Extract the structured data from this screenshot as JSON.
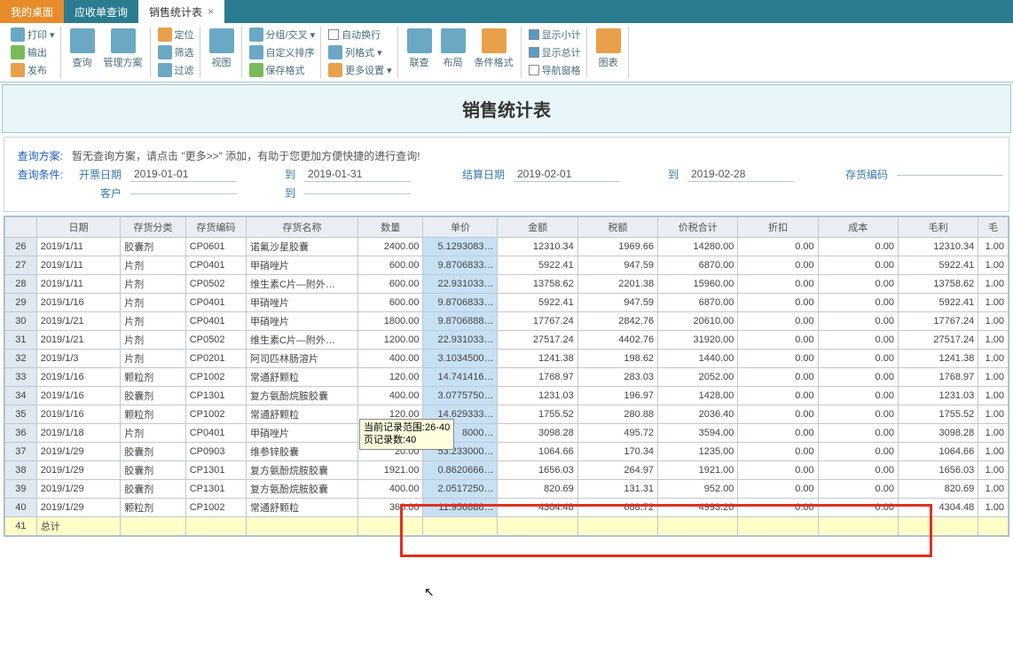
{
  "tabs": {
    "desktop": "我的桌面",
    "ar": "应收单查询",
    "active": "销售统计表"
  },
  "ribbon": {
    "print": "打印",
    "export": "输出",
    "publish": "发布",
    "query": "查询",
    "scheme": "管理方案",
    "locate": "定位",
    "filter": "筛选",
    "clearfilter": "过滤",
    "view": "视图",
    "group": "分组/交叉",
    "customsort": "自定义排序",
    "saveformat": "保存格式",
    "autowrap": "自动换行",
    "colformat": "列格式",
    "moresetting": "更多设置",
    "related": "联查",
    "layout": "布局",
    "condformat": "条件格式",
    "subtotal": "显示小计",
    "grandtotal": "显示总计",
    "navpane": "导航窗格",
    "chart": "图表"
  },
  "title": "销售统计表",
  "query": {
    "scheme_label": "查询方案:",
    "scheme_hint": "暂无查询方案，请点击 \"更多>>\" 添加，有助于您更加方便快捷的进行查询!",
    "cond_label": "查询条件:",
    "invoice_date": "开票日期",
    "d1": "2019-01-01",
    "to": "到",
    "d2": "2019-01-31",
    "settle_date": "结算日期",
    "d3": "2019-02-01",
    "d4": "2019-02-28",
    "inv_code": "存货编码",
    "customer": "客户"
  },
  "headers": [
    "日期",
    "存货分类",
    "存货编码",
    "存货名称",
    "数量",
    "单价",
    "金额",
    "税额",
    "价税合计",
    "折扣",
    "成本",
    "毛利",
    "毛"
  ],
  "tooltip": {
    "l1": "当前记录范围:26-40",
    "l2": "页记录数:40"
  },
  "rows": [
    {
      "n": 26,
      "date": "2019/1/11",
      "cat": "胶囊剂",
      "code": "CP0601",
      "name": "诺氟沙星胶囊",
      "qty": "2400.00",
      "price": "5.1293083…",
      "amt": "12310.34",
      "tax": "1969.66",
      "tot": "14280.00",
      "disc": "0.00",
      "cost": "0.00",
      "gp": "12310.34",
      "r": "1.00"
    },
    {
      "n": 27,
      "date": "2019/1/11",
      "cat": "片剂",
      "code": "CP0401",
      "name": "甲硝唑片",
      "qty": "600.00",
      "price": "9.8706833…",
      "amt": "5922.41",
      "tax": "947.59",
      "tot": "6870.00",
      "disc": "0.00",
      "cost": "0.00",
      "gp": "5922.41",
      "r": "1.00"
    },
    {
      "n": 28,
      "date": "2019/1/11",
      "cat": "片剂",
      "code": "CP0502",
      "name": "维生素C片—附外…",
      "qty": "600.00",
      "price": "22.931033…",
      "amt": "13758.62",
      "tax": "2201.38",
      "tot": "15960.00",
      "disc": "0.00",
      "cost": "0.00",
      "gp": "13758.62",
      "r": "1.00"
    },
    {
      "n": 29,
      "date": "2019/1/16",
      "cat": "片剂",
      "code": "CP0401",
      "name": "甲硝唑片",
      "qty": "600.00",
      "price": "9.8706833…",
      "amt": "5922.41",
      "tax": "947.59",
      "tot": "6870.00",
      "disc": "0.00",
      "cost": "0.00",
      "gp": "5922.41",
      "r": "1.00"
    },
    {
      "n": 30,
      "date": "2019/1/21",
      "cat": "片剂",
      "code": "CP0401",
      "name": "甲硝唑片",
      "qty": "1800.00",
      "price": "9.8706888…",
      "amt": "17767.24",
      "tax": "2842.76",
      "tot": "20610.00",
      "disc": "0.00",
      "cost": "0.00",
      "gp": "17767.24",
      "r": "1.00"
    },
    {
      "n": 31,
      "date": "2019/1/21",
      "cat": "片剂",
      "code": "CP0502",
      "name": "维生素C片—附外…",
      "qty": "1200.00",
      "price": "22.931033…",
      "amt": "27517.24",
      "tax": "4402.76",
      "tot": "31920.00",
      "disc": "0.00",
      "cost": "0.00",
      "gp": "27517.24",
      "r": "1.00"
    },
    {
      "n": 32,
      "date": "2019/1/3",
      "cat": "片剂",
      "code": "CP0201",
      "name": "阿司匹林肠溶片",
      "qty": "400.00",
      "price": "3.1034500…",
      "amt": "1241.38",
      "tax": "198.62",
      "tot": "1440.00",
      "disc": "0.00",
      "cost": "0.00",
      "gp": "1241.38",
      "r": "1.00"
    },
    {
      "n": 33,
      "date": "2019/1/16",
      "cat": "颗粒剂",
      "code": "CP1002",
      "name": "常通舒颗粒",
      "qty": "120.00",
      "price": "14.741416…",
      "amt": "1768.97",
      "tax": "283.03",
      "tot": "2052.00",
      "disc": "0.00",
      "cost": "0.00",
      "gp": "1768.97",
      "r": "1.00"
    },
    {
      "n": 34,
      "date": "2019/1/16",
      "cat": "胶囊剂",
      "code": "CP1301",
      "name": "复方氨酚烷胺胶囊",
      "qty": "400.00",
      "price": "3.0775750…",
      "amt": "1231.03",
      "tax": "196.97",
      "tot": "1428.00",
      "disc": "0.00",
      "cost": "0.00",
      "gp": "1231.03",
      "r": "1.00"
    },
    {
      "n": 35,
      "date": "2019/1/16",
      "cat": "颗粒剂",
      "code": "CP1002",
      "name": "常通舒颗粒",
      "qty": "120.00",
      "price": "14.629333…",
      "amt": "1755.52",
      "tax": "280.88",
      "tot": "2036.40",
      "disc": "0.00",
      "cost": "0.00",
      "gp": "1755.52",
      "r": "1.00"
    },
    {
      "n": 36,
      "date": "2019/1/18",
      "cat": "片剂",
      "code": "CP0401",
      "name": "甲硝唑片",
      "qty": "",
      "price": "8000…",
      "amt": "3098.28",
      "tax": "495.72",
      "tot": "3594.00",
      "disc": "0.00",
      "cost": "0.00",
      "gp": "3098.28",
      "r": "1.00"
    },
    {
      "n": 37,
      "date": "2019/1/29",
      "cat": "胶囊剂",
      "code": "CP0903",
      "name": "维参锌胶囊",
      "qty": "20.00",
      "price": "53.233000…",
      "amt": "1064.66",
      "tax": "170.34",
      "tot": "1235.00",
      "disc": "0.00",
      "cost": "0.00",
      "gp": "1064.66",
      "r": "1.00"
    },
    {
      "n": 38,
      "date": "2019/1/29",
      "cat": "胶囊剂",
      "code": "CP1301",
      "name": "复方氨酚烷胺胶囊",
      "qty": "1921.00",
      "price": "0.8620666…",
      "amt": "1656.03",
      "tax": "264.97",
      "tot": "1921.00",
      "disc": "0.00",
      "cost": "0.00",
      "gp": "1656.03",
      "r": "1.00"
    },
    {
      "n": 39,
      "date": "2019/1/29",
      "cat": "胶囊剂",
      "code": "CP1301",
      "name": "复方氨酚烷胺胶囊",
      "qty": "400.00",
      "price": "2.0517250…",
      "amt": "820.69",
      "tax": "131.31",
      "tot": "952.00",
      "disc": "0.00",
      "cost": "0.00",
      "gp": "820.69",
      "r": "1.00"
    },
    {
      "n": 40,
      "date": "2019/1/29",
      "cat": "颗粒剂",
      "code": "CP1002",
      "name": "常通舒颗粒",
      "qty": "360.00",
      "price": "11.956888…",
      "amt": "4304.48",
      "tax": "688.72",
      "tot": "4993.20",
      "disc": "0.00",
      "cost": "0.00",
      "gp": "4304.48",
      "r": "1.00"
    }
  ],
  "total_row": {
    "n": 41,
    "label": "总计"
  }
}
